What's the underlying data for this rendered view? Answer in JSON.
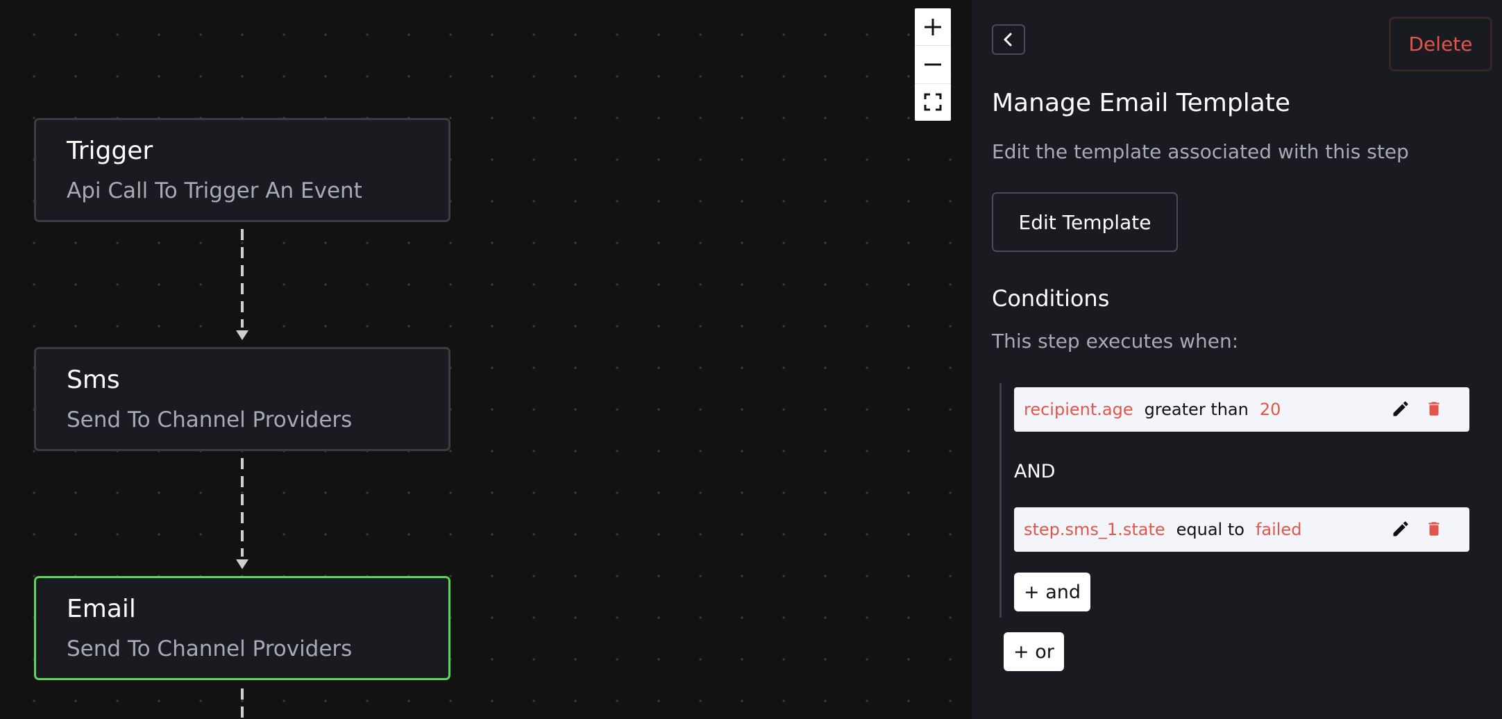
{
  "canvas": {
    "nodes": [
      {
        "title": "Trigger",
        "subtitle": "Api Call To Trigger An Event",
        "selected": false
      },
      {
        "title": "Sms",
        "subtitle": "Send To Channel Providers",
        "selected": false
      },
      {
        "title": "Email",
        "subtitle": "Send To Channel Providers",
        "selected": true
      }
    ],
    "zoom_controls": [
      {
        "icon": "plus-icon",
        "action": "zoom in"
      },
      {
        "icon": "minus-icon",
        "action": "zoom out"
      },
      {
        "icon": "fit-view-icon",
        "action": "fit view"
      }
    ],
    "colors": {
      "background": "#121212",
      "node_bg": "#1a1b20",
      "node_border": "#3a3d44",
      "selected_border": "#5bd85b"
    }
  },
  "panel": {
    "back_icon": "chevron-left-icon",
    "delete_label": "Delete",
    "title": "Manage Email Template",
    "description": "Edit the template associated with this step",
    "edit_template_label": "Edit Template",
    "conditions_heading": "Conditions",
    "conditions_description": "This step executes when:",
    "conditions": [
      {
        "field": "recipient.age",
        "operator": "greater than",
        "value": "20"
      },
      {
        "field": "step.sms_1.state",
        "operator": "equal to",
        "value": "failed"
      }
    ],
    "joiner": "AND",
    "add_and_label": "+ and",
    "add_or_label": "+ or",
    "colors": {
      "accent_red": "#e2554a",
      "panel_bg": "#1a1b20",
      "condition_bg": "#f4f5fa"
    }
  }
}
